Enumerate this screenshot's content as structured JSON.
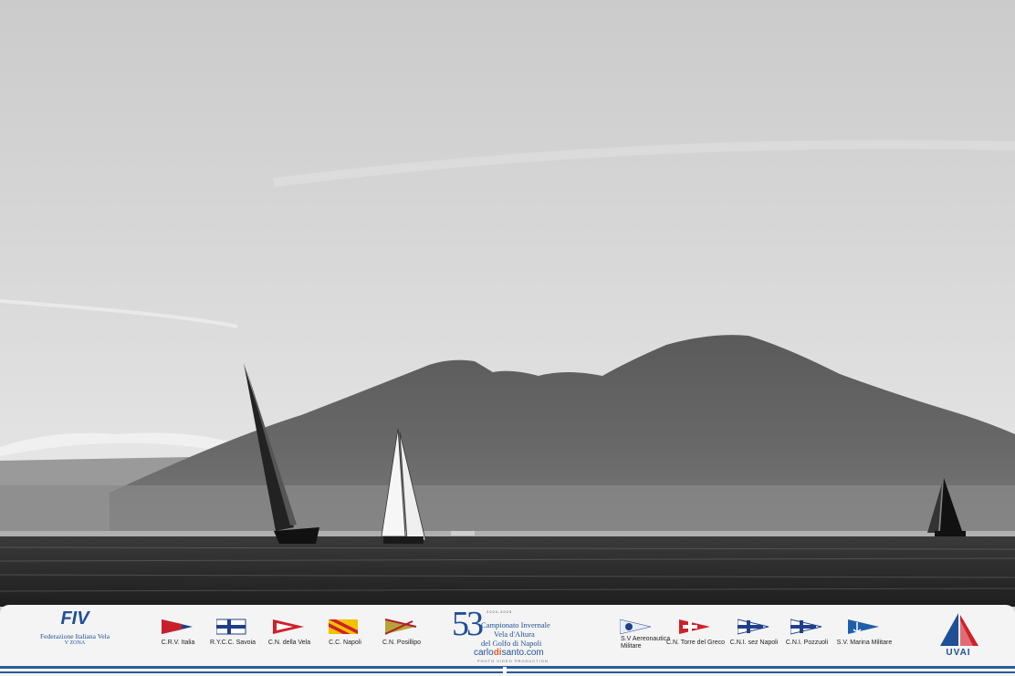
{
  "scene": {
    "description_colors": {
      "sky_top": "#d2d2d2",
      "sky_bottom": "#e6e6e6",
      "mountain": "#5f5f5f",
      "sea": "#2e2e2e"
    }
  },
  "footer": {
    "fiv": {
      "logo_text": "FIV",
      "org_name": "Federazione Italiana Vela",
      "zone": "V ZONA"
    },
    "clubs_left": [
      {
        "name": "C.R.V. Italia"
      },
      {
        "name": "R.Y.C.C. Savoia"
      },
      {
        "name": "C.N. della Vela"
      },
      {
        "name": "C.C. Napoli"
      },
      {
        "name": "C.N. Posillipo"
      }
    ],
    "championship": {
      "number": "53",
      "years": "2024-2025",
      "line1": "Campionato Invernale",
      "line2": "Vela d'Altura",
      "line3": "del Golfo di Napoli",
      "site_pre": "carlo",
      "site_hl": "di",
      "site_post": "santo.com",
      "credit": "PHOTO VIDEO PRODUCTION"
    },
    "clubs_right": [
      {
        "name": "S.V Aereonautica",
        "name2": "Militare"
      },
      {
        "name": "C.N. Torre del Greco"
      },
      {
        "name": "C.N.I. sez Napoli"
      },
      {
        "name": "C.N.I. Pozzuoli"
      },
      {
        "name": "S.V. Marina Militare"
      }
    ],
    "uvai": {
      "text": "UVAI"
    },
    "colors": {
      "brand_blue": "#1f4f96",
      "accent_red": "#d0202a",
      "accent_orange": "#e85a2a"
    }
  }
}
